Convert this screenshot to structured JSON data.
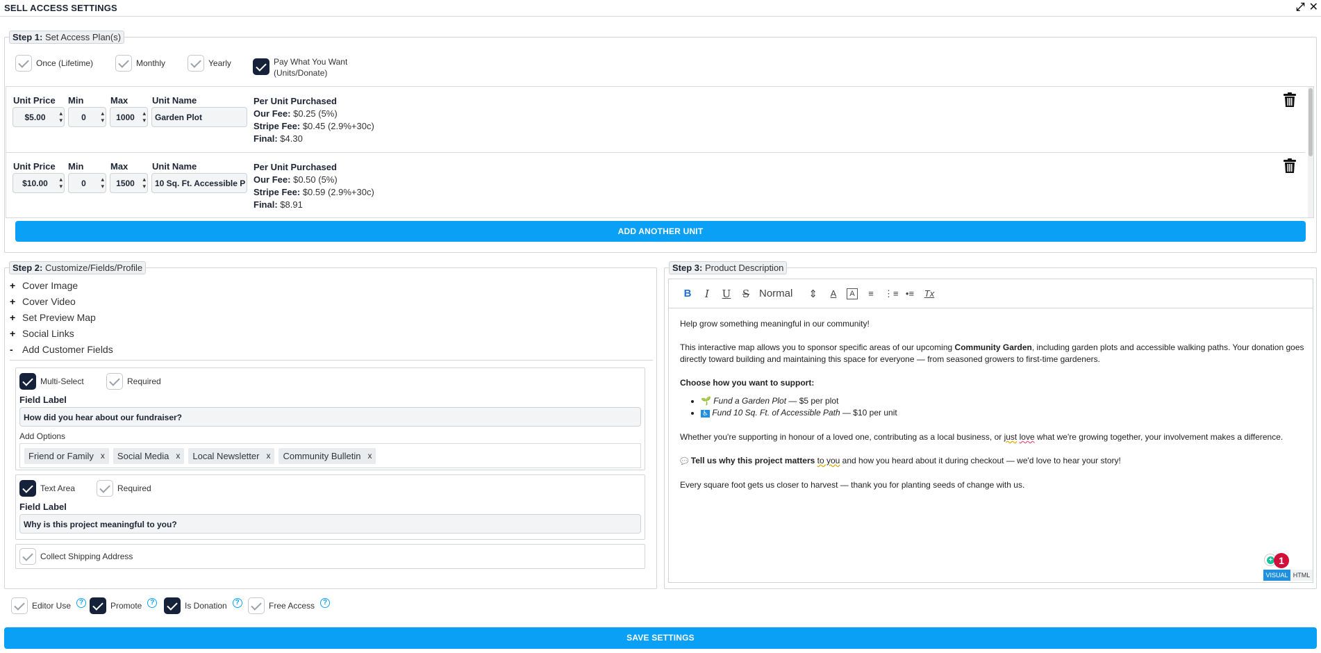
{
  "window": {
    "title": "SELL ACCESS SETTINGS"
  },
  "step1": {
    "legend_step": "Step 1:",
    "legend_text": "Set Access Plan(s)",
    "plans": [
      {
        "label": "Once (Lifetime)",
        "checked": false
      },
      {
        "label": "Monthly",
        "checked": false
      },
      {
        "label": "Yearly",
        "checked": false
      },
      {
        "label_line1": "Pay What You Want",
        "label_line2": "(Units/Donate)",
        "checked": true
      }
    ],
    "unit_headers": {
      "unit_price": "Unit Price",
      "min": "Min",
      "max": "Max",
      "unit_name": "Unit Name"
    },
    "units": [
      {
        "unit_price": "$5.00",
        "min": "0",
        "max": "1000",
        "unit_name": "Garden Plot",
        "per_unit_label": "Per Unit Purchased",
        "our_fee_label": "Our Fee:",
        "our_fee": "$0.25 (5%)",
        "stripe_fee_label": "Stripe Fee:",
        "stripe_fee": "$0.45 (2.9%+30c)",
        "final_label": "Final:",
        "final": "$4.30"
      },
      {
        "unit_price": "$10.00",
        "min": "0",
        "max": "1500",
        "unit_name": "10 Sq. Ft. Accessible P",
        "per_unit_label": "Per Unit Purchased",
        "our_fee_label": "Our Fee:",
        "our_fee": "$0.50 (5%)",
        "stripe_fee_label": "Stripe Fee:",
        "stripe_fee": "$0.59 (2.9%+30c)",
        "final_label": "Final:",
        "final": "$8.91"
      }
    ],
    "add_unit_label": "ADD ANOTHER UNIT"
  },
  "step2": {
    "legend_step": "Step 2:",
    "legend_text": "Customize/Fields/Profile",
    "sections": [
      {
        "symbol": "+",
        "label": "Cover Image"
      },
      {
        "symbol": "+",
        "label": "Cover Video"
      },
      {
        "symbol": "+",
        "label": "Set Preview Map"
      },
      {
        "symbol": "+",
        "label": "Social Links"
      },
      {
        "symbol": "-",
        "label": "Add Customer Fields"
      }
    ],
    "fields": [
      {
        "type_label": "Multi-Select",
        "required_label": "Required",
        "field_label_title": "Field Label",
        "field_label": "How did you hear about our fundraiser?",
        "options_title": "Add Options",
        "options": [
          "Friend or Family",
          "Social Media",
          "Local Newsletter",
          "Community Bulletin"
        ]
      },
      {
        "type_label": "Text Area",
        "required_label": "Required",
        "field_label_title": "Field Label",
        "field_label": "Why is this project meaningful to you?"
      }
    ],
    "shipping_label": "Collect Shipping Address",
    "remove_symbol": "x"
  },
  "step3": {
    "legend_step": "Step 3:",
    "legend_text": "Product Description",
    "toolbar": {
      "bold": "B",
      "italic": "I",
      "underline": "U",
      "strike": "S",
      "format": "Normal",
      "format_arrow": "⇕",
      "color": "A",
      "bg": "A",
      "align": "≡",
      "ordered": "⋮≡",
      "bullet": "•≡",
      "clear": "Tx"
    },
    "paragraphs": {
      "p1": "Help grow something meaningful in our community!",
      "p2a": "This interactive map allows you to sponsor specific areas of our upcoming ",
      "p2b": "Community Garden",
      "p2c": ", including garden plots and accessible walking paths. Your donation goes directly toward building and maintaining this space for everyone — from seasoned growers to first-time gardeners.",
      "p3": "Choose how you want to support:",
      "li1_icon": "🌱",
      "li1_em": "Fund a Garden Plot",
      "li1_rest": " — $5 per plot",
      "li2_icon": "♿",
      "li2_em": "Fund 10 Sq. Ft. of Accessible Path",
      "li2_rest": " — $10 per unit",
      "p4a": "Whether you're supporting in honour of a loved one, contributing as a local business, or ",
      "p4b": "just",
      "p4c": " ",
      "p4d": "love",
      "p4e": " what we're growing together, your involvement makes a difference.",
      "p5_icon": "💬",
      "p5a": "Tell us why this project matters ",
      "p5b": "to you",
      "p5c": " and how you heard about it during checkout — we'd love to hear your story!",
      "p6": "Every square foot gets us closer to harvest — thank you for planting seeds of change with us."
    },
    "badge_count": "1",
    "mode_visual": "VISUAL",
    "mode_html": "HTML"
  },
  "footer": {
    "options": [
      {
        "label": "Editor Use",
        "checked": false
      },
      {
        "label": "Promote",
        "checked": true
      },
      {
        "label": "Is Donation",
        "checked": true
      },
      {
        "label": "Free Access",
        "checked": false
      }
    ],
    "help_symbol": "?",
    "save_label": "SAVE SETTINGS"
  },
  "colors": {
    "accent": "#0aa0f5",
    "checked": "#16213a",
    "badge": "#d0103a",
    "link_active": "#1f6fd6"
  }
}
